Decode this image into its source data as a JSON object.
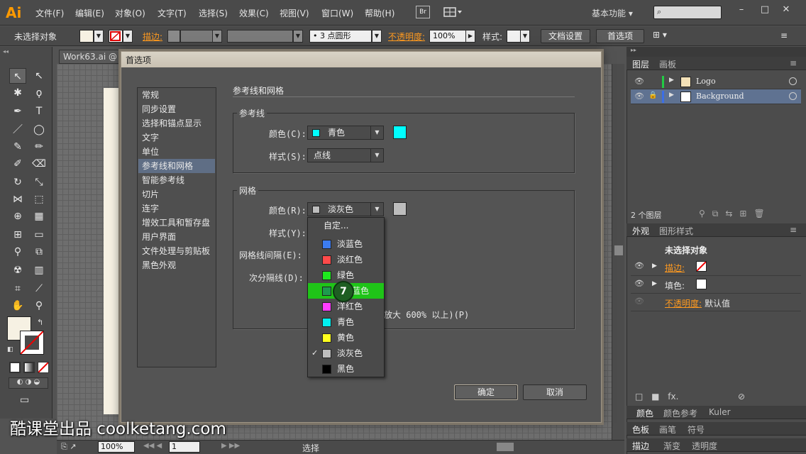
{
  "app": {
    "logo": "Ai",
    "br": "Br",
    "workspace": "基本功能 ▾"
  },
  "menu": [
    "文件(F)",
    "编辑(E)",
    "对象(O)",
    "文字(T)",
    "选择(S)",
    "效果(C)",
    "视图(V)",
    "窗口(W)",
    "帮助(H)"
  ],
  "control": {
    "selection": "未选择对象",
    "stroke": "描边:",
    "brush": "3 点圆形",
    "opacity": "不透明度:",
    "opacity_val": "100%",
    "style": "样式:",
    "doc_setup": "文档设置",
    "prefs": "首选项"
  },
  "doc": {
    "tab": "Work63.ai @"
  },
  "status": {
    "zoom": "100%",
    "page": "1",
    "tool": "选择"
  },
  "dialog": {
    "title": "首选项",
    "categories": [
      "常规",
      "同步设置",
      "选择和锚点显示",
      "文字",
      "单位",
      "参考线和网格",
      "智能参考线",
      "切片",
      "连字",
      "增效工具和暂存盘",
      "用户界面",
      "文件处理与剪贴板",
      "黑色外观"
    ],
    "selected_category": "参考线和网格",
    "section_title": "参考线和网格",
    "guides": {
      "group": "参考线",
      "color_label": "颜色(C):",
      "color_value": "青色",
      "color_hex": "#00ffff",
      "style_label": "样式(S):",
      "style_value": "点线"
    },
    "grid": {
      "group": "网格",
      "color_label": "颜色(R):",
      "color_value": "淡灰色",
      "color_hex": "#bdbdbd",
      "style_label": "样式(Y):",
      "spacing_label": "网格线间隔(E):",
      "subdiv_label": "次分隔线(D):",
      "checkbox_tail": "放大 600% 以上)(P)"
    },
    "dropdown": {
      "custom": "自定...",
      "options": [
        {
          "label": "淡蓝色",
          "color": "#3c7cf0"
        },
        {
          "label": "淡红色",
          "color": "#ff4a4a"
        },
        {
          "label": "绿色",
          "color": "#1ee81e"
        },
        {
          "label": "蓝色",
          "color": "#1e9b4e",
          "highlight": true
        },
        {
          "label": "洋红色",
          "color": "#ff3dff"
        },
        {
          "label": "青色",
          "color": "#00f0f0"
        },
        {
          "label": "黄色",
          "color": "#ffff1e"
        },
        {
          "label": "淡灰色",
          "color": "#bdbdbd",
          "checked": true
        },
        {
          "label": "黑色",
          "color": "#000000"
        }
      ],
      "check": "✓"
    },
    "step_badge": "7",
    "ok": "确定",
    "cancel": "取消"
  },
  "panels": {
    "layers_tabs": [
      "图层",
      "画板"
    ],
    "layers": [
      {
        "name": "Logo",
        "bar": "#22cc44"
      },
      {
        "name": "Background",
        "bar": "#3b6ee6"
      }
    ],
    "layer_count": "2 个图层",
    "appearance_tabs": [
      "外观",
      "图形样式"
    ],
    "appearance_title": "未选择对象",
    "stroke_label": "描边:",
    "fill_label": "填色:",
    "opacity_label": "不透明度:",
    "opacity_value": "默认值",
    "bottom_tabs1": [
      "颜色",
      "颜色参考",
      "Kuler"
    ],
    "bottom_tabs2": [
      "色板",
      "画笔",
      "符号"
    ],
    "bottom_tabs3": [
      "描边",
      "渐变",
      "透明度"
    ]
  },
  "watermark": "酷课堂出品 coolketang.com"
}
